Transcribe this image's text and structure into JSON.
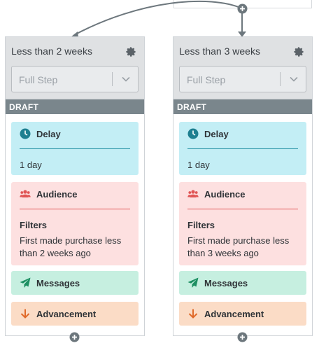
{
  "steps": [
    {
      "title": "Less than 2 weeks",
      "select_value": "Full Step",
      "status": "DRAFT",
      "delay": {
        "label": "Delay",
        "value": "1 day"
      },
      "audience": {
        "label": "Audience",
        "filters_label": "Filters",
        "filter_text": "First made purchase less than 2 weeks ago"
      },
      "messages": {
        "label": "Messages"
      },
      "advancement": {
        "label": "Advancement"
      }
    },
    {
      "title": "Less than 3 weeks",
      "select_value": "Full Step",
      "status": "DRAFT",
      "delay": {
        "label": "Delay",
        "value": "1 day"
      },
      "audience": {
        "label": "Audience",
        "filters_label": "Filters",
        "filter_text": "First made purchase less than 3 weeks ago"
      },
      "messages": {
        "label": "Messages"
      },
      "advancement": {
        "label": "Advancement"
      }
    }
  ],
  "colors": {
    "delay": "#c3eef5",
    "audience": "#fde0e0",
    "messages": "#c6efe0",
    "advancement": "#fbdcc6",
    "draft_bar": "#7a868c",
    "connector": "#6d777d"
  },
  "icons": {
    "delay": "clock-icon",
    "audience": "users-icon",
    "messages": "paper-plane-icon",
    "advancement": "arrow-down-icon",
    "settings": "gear-icon",
    "dropdown": "chevron-down-icon",
    "add": "plus-circle-icon"
  }
}
